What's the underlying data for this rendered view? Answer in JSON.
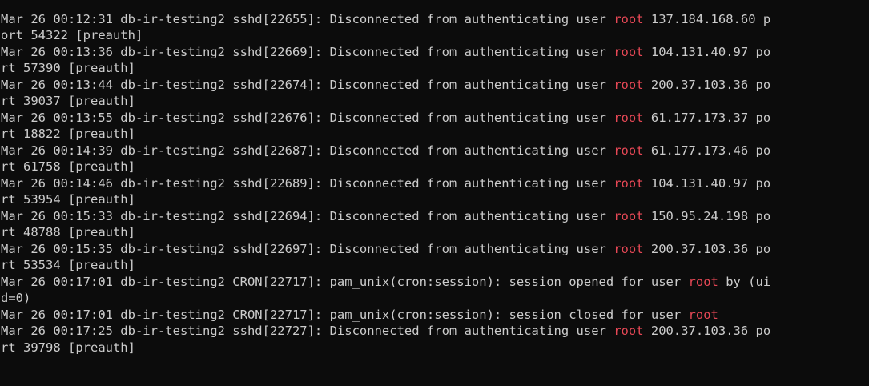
{
  "terminal": {
    "text_color": "#cccccc",
    "background": "#0c0c0c",
    "highlight_color": "#e74856",
    "lines": [
      {
        "pre": "",
        "hl": "",
        "post": ""
      },
      {
        "pre": "Mar 26 00:12:31 db-ir-testing2 sshd[22655]: Disconnected from authenticating user ",
        "hl": "root",
        "post": " 137.184.168.60 p"
      },
      {
        "pre": "ort 54322 [preauth]",
        "hl": "",
        "post": ""
      },
      {
        "pre": "Mar 26 00:13:36 db-ir-testing2 sshd[22669]: Disconnected from authenticating user ",
        "hl": "root",
        "post": " 104.131.40.97 po"
      },
      {
        "pre": "rt 57390 [preauth]",
        "hl": "",
        "post": ""
      },
      {
        "pre": "Mar 26 00:13:44 db-ir-testing2 sshd[22674]: Disconnected from authenticating user ",
        "hl": "root",
        "post": " 200.37.103.36 po"
      },
      {
        "pre": "rt 39037 [preauth]",
        "hl": "",
        "post": ""
      },
      {
        "pre": "Mar 26 00:13:55 db-ir-testing2 sshd[22676]: Disconnected from authenticating user ",
        "hl": "root",
        "post": " 61.177.173.37 po"
      },
      {
        "pre": "rt 18822 [preauth]",
        "hl": "",
        "post": ""
      },
      {
        "pre": "Mar 26 00:14:39 db-ir-testing2 sshd[22687]: Disconnected from authenticating user ",
        "hl": "root",
        "post": " 61.177.173.46 po"
      },
      {
        "pre": "rt 61758 [preauth]",
        "hl": "",
        "post": ""
      },
      {
        "pre": "Mar 26 00:14:46 db-ir-testing2 sshd[22689]: Disconnected from authenticating user ",
        "hl": "root",
        "post": " 104.131.40.97 po"
      },
      {
        "pre": "rt 53954 [preauth]",
        "hl": "",
        "post": ""
      },
      {
        "pre": "Mar 26 00:15:33 db-ir-testing2 sshd[22694]: Disconnected from authenticating user ",
        "hl": "root",
        "post": " 150.95.24.198 po"
      },
      {
        "pre": "rt 48788 [preauth]",
        "hl": "",
        "post": ""
      },
      {
        "pre": "Mar 26 00:15:35 db-ir-testing2 sshd[22697]: Disconnected from authenticating user ",
        "hl": "root",
        "post": " 200.37.103.36 po"
      },
      {
        "pre": "rt 53534 [preauth]",
        "hl": "",
        "post": ""
      },
      {
        "pre": "Mar 26 00:17:01 db-ir-testing2 CRON[22717]: pam_unix(cron:session): session opened for user ",
        "hl": "root",
        "post": " by (ui"
      },
      {
        "pre": "d=0)",
        "hl": "",
        "post": ""
      },
      {
        "pre": "Mar 26 00:17:01 db-ir-testing2 CRON[22717]: pam_unix(cron:session): session closed for user ",
        "hl": "root",
        "post": ""
      },
      {
        "pre": "Mar 26 00:17:25 db-ir-testing2 sshd[22727]: Disconnected from authenticating user ",
        "hl": "root",
        "post": " 200.37.103.36 po"
      },
      {
        "pre": "rt 39798 [preauth]",
        "hl": "",
        "post": ""
      }
    ]
  }
}
